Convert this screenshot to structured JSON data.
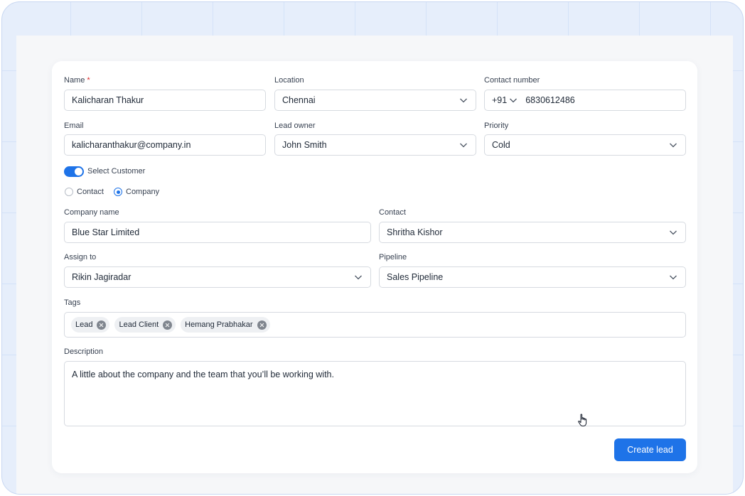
{
  "form": {
    "name": {
      "label": "Name",
      "required_mark": "*",
      "value": "Kalicharan Thakur"
    },
    "location": {
      "label": "Location",
      "value": "Chennai"
    },
    "contact_number": {
      "label": "Contact number",
      "country_code": "+91",
      "value": "6830612486"
    },
    "email": {
      "label": "Email",
      "value": "kalicharanthakur@company.in"
    },
    "lead_owner": {
      "label": "Lead owner",
      "value": "John Smith"
    },
    "priority": {
      "label": "Priority",
      "value": "Cold"
    },
    "select_customer": {
      "label": "Select Customer",
      "enabled": true
    },
    "customer_type": {
      "options": [
        "Contact",
        "Company"
      ],
      "selected": "Company"
    },
    "company_name": {
      "label": "Company name",
      "value": "Blue Star Limited"
    },
    "contact": {
      "label": "Contact",
      "value": "Shritha Kishor"
    },
    "assign_to": {
      "label": "Assign to",
      "value": "Rikin Jagiradar"
    },
    "pipeline": {
      "label": "Pipeline",
      "value": "Sales Pipeline"
    },
    "tags": {
      "label": "Tags",
      "items": [
        "Lead",
        "Lead Client",
        "Hemang Prabhakar"
      ]
    },
    "description": {
      "label": "Description",
      "value": "A little about the company and the team that you’ll be working with."
    },
    "submit_label": "Create lead"
  },
  "colors": {
    "accent": "#1e73e8",
    "required": "#dc2626",
    "frame": "#e6eefb"
  },
  "icons": {
    "dropdown": "chevron-down-icon",
    "tag_remove": "close-circle-icon",
    "cursor": "hand-pointer-icon"
  }
}
